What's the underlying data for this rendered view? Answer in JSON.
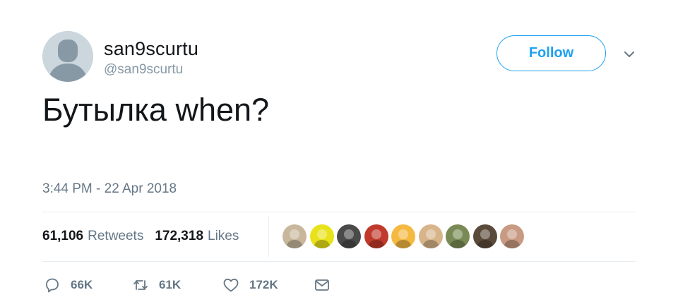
{
  "user": {
    "display_name": "san9scurtu",
    "handle": "@san9scurtu",
    "avatar_icon": "default-avatar-icon"
  },
  "follow_label": "Follow",
  "menu_icon": "chevron-down-icon",
  "tweet_text": "Бутылка when?",
  "timestamp": "3:44 PM - 22 Apr 2018",
  "stats": {
    "retweets_count": "61,106",
    "retweets_label": "Retweets",
    "likes_count": "172,318",
    "likes_label": "Likes"
  },
  "likers": [
    {
      "icon": "liker-avatar-1",
      "color": "#c9b79c"
    },
    {
      "icon": "liker-avatar-2",
      "color": "#e8e21a"
    },
    {
      "icon": "liker-avatar-3",
      "color": "#4a4a4a"
    },
    {
      "icon": "liker-avatar-4",
      "color": "#c0392b"
    },
    {
      "icon": "liker-avatar-5",
      "color": "#f5b942"
    },
    {
      "icon": "liker-avatar-6",
      "color": "#d8b48a"
    },
    {
      "icon": "liker-avatar-7",
      "color": "#7a8a55"
    },
    {
      "icon": "liker-avatar-8",
      "color": "#5a4a3a"
    },
    {
      "icon": "liker-avatar-9",
      "color": "#c89a82"
    }
  ],
  "actions": {
    "reply_count": "66K",
    "retweet_count": "61K",
    "like_count": "172K"
  },
  "colors": {
    "accent": "#1da1f2",
    "text": "#14171a",
    "secondary": "#657786",
    "border": "#e6ecf0"
  }
}
